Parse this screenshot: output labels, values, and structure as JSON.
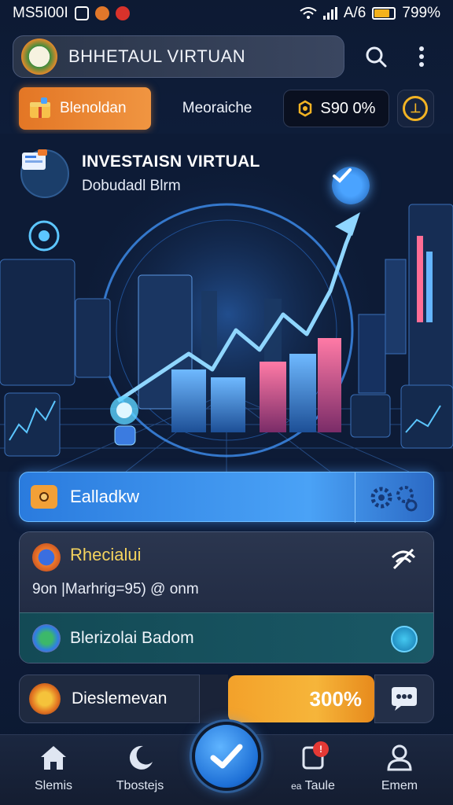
{
  "status_bar": {
    "carrier": "MS5I00I",
    "battery_text": "799%",
    "network_text": "A/6"
  },
  "app_bar": {
    "title": "BHHETAUL VIRTUAN"
  },
  "tabs": {
    "active_label": "Blenoldan",
    "second_label": "Meoraiche",
    "balance": "S90 0%"
  },
  "hero": {
    "title": "INVESTAISN VIRTUAL",
    "subtitle": "Dobudadl Blrm"
  },
  "action_card": {
    "label": "Ealladkw"
  },
  "panel": {
    "title": "Rhecialui",
    "line": "9on |Marhrig=95) @ onm",
    "bottom_label": "Blerizolai Badom"
  },
  "bottom_card": {
    "label": "Dieslemevan",
    "value": "300%"
  },
  "nav": {
    "items": [
      {
        "label": "Slemis",
        "icon": "home-icon"
      },
      {
        "label": "Tbostejs",
        "icon": "moon-icon"
      },
      {
        "label": "Taule",
        "icon": "notification-icon",
        "prefix": "ea"
      },
      {
        "label": "Emem",
        "icon": "profile-icon"
      }
    ],
    "badge": "!"
  },
  "colors": {
    "accent_orange": "#f09541",
    "accent_blue": "#3a8ef0",
    "background": "#0f2142",
    "highlight_yellow": "#f4d35e"
  }
}
